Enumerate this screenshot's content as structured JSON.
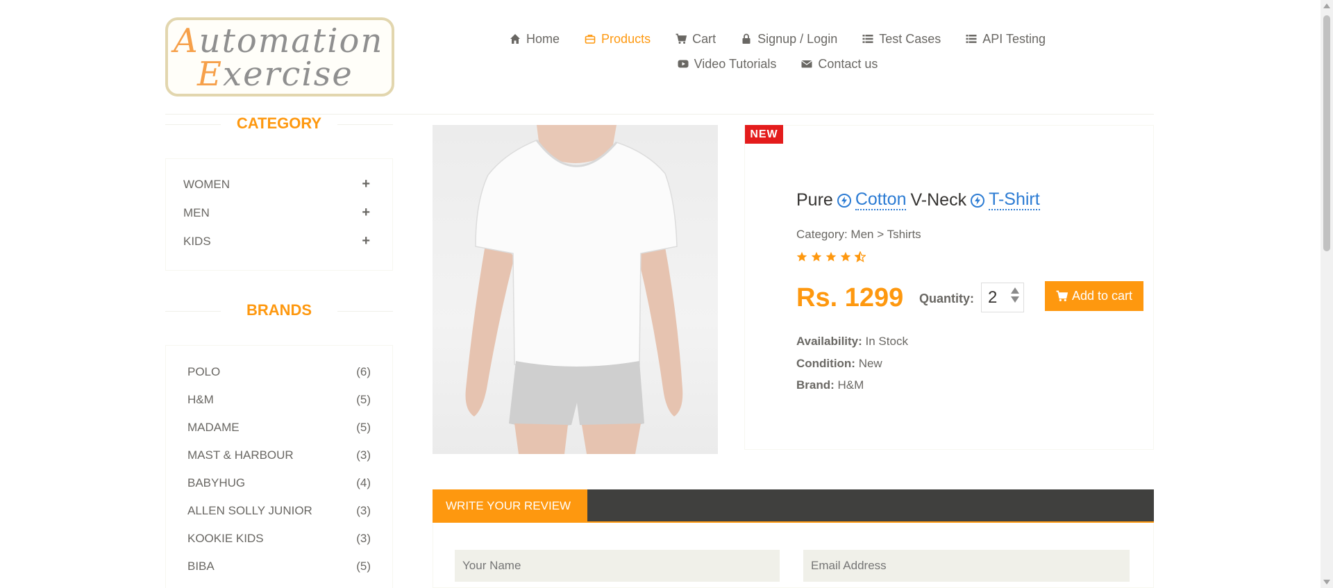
{
  "logo": {
    "line1_cap": "A",
    "line1_rest": "utomation",
    "line2_cap": "E",
    "line2_rest": "xercise"
  },
  "nav": {
    "row1": [
      {
        "label": "Home",
        "icon": "home-icon"
      },
      {
        "label": "Products",
        "icon": "briefcase-icon",
        "active": true
      },
      {
        "label": "Cart",
        "icon": "cart-icon"
      },
      {
        "label": "Signup / Login",
        "icon": "lock-icon"
      },
      {
        "label": "Test Cases",
        "icon": "list-icon"
      },
      {
        "label": "API Testing",
        "icon": "list-icon"
      }
    ],
    "row2": [
      {
        "label": "Video Tutorials",
        "icon": "youtube-play-icon"
      },
      {
        "label": "Contact us",
        "icon": "envelope-icon"
      }
    ]
  },
  "sidebar": {
    "category_title": "CATEGORY",
    "categories": [
      "WOMEN",
      "MEN",
      "KIDS"
    ],
    "brands_title": "BRANDS",
    "brands": [
      {
        "name": "POLO",
        "count": "(6)"
      },
      {
        "name": "H&M",
        "count": "(5)"
      },
      {
        "name": "MADAME",
        "count": "(5)"
      },
      {
        "name": "MAST & HARBOUR",
        "count": "(3)"
      },
      {
        "name": "BABYHUG",
        "count": "(4)"
      },
      {
        "name": "ALLEN SOLLY JUNIOR",
        "count": "(3)"
      },
      {
        "name": "KOOKIE KIDS",
        "count": "(3)"
      },
      {
        "name": "BIBA",
        "count": "(5)"
      }
    ]
  },
  "product": {
    "badge": "NEW",
    "title_part1": "Pure",
    "title_link1": "Cotton",
    "title_part2": "V-Neck",
    "title_link2": "T-Shirt",
    "category": "Category: Men > Tshirts",
    "rating": 4.5,
    "price": "Rs. 1299",
    "quantity_label": "Quantity:",
    "quantity_value": "2",
    "add_to_cart": "Add to cart",
    "availability_label": "Availability:",
    "availability_value": " In Stock",
    "condition_label": "Condition:",
    "condition_value": " New",
    "brand_label": "Brand:",
    "brand_value": " H&M"
  },
  "review": {
    "tab_label": "WRITE YOUR REVIEW",
    "name_placeholder": "Your Name",
    "email_placeholder": "Email Address"
  },
  "colors": {
    "accent": "#fe980f",
    "text": "#696763",
    "new_badge": "#e41c1c",
    "link": "#2b7bd3",
    "review_bar": "#40403e"
  }
}
